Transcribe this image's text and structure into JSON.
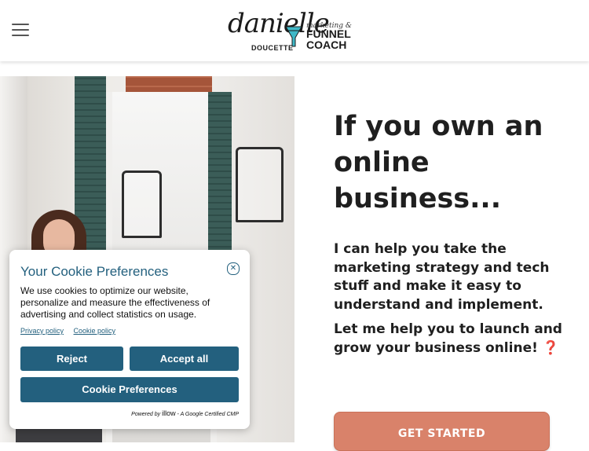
{
  "header": {
    "menu_icon": "hamburger-menu-icon",
    "logo": {
      "script_name": "danielle",
      "surname": "DOUCETTE",
      "tagline_top": "marketing &",
      "tagline_mid": "FUNNEL",
      "tagline_bottom": "COACH"
    }
  },
  "hero": {
    "headline": "If you own an online business...",
    "paragraph1": "I can help you take the marketing strategy and tech stuff and make it easy to understand and implement.",
    "paragraph2": "Let me help you to launch and grow your business online! ❓",
    "cta_label": "GET STARTED"
  },
  "cookie": {
    "title": "Your Cookie Preferences",
    "description": "We use cookies to optimize our website, personalize and measure the effectiveness of advertising and collect statistics on usage.",
    "privacy_link": "Privacy policy",
    "cookie_link": "Cookie policy",
    "reject_label": "Reject",
    "accept_label": "Accept all",
    "preferences_label": "Cookie Preferences",
    "powered_prefix": "Powered by",
    "powered_brand": "illow",
    "powered_suffix": "- A Google Certified CMP",
    "close_icon": "close-icon"
  },
  "colors": {
    "cookie_accent": "#23607e",
    "cta": "#d9826a",
    "text": "#1f1f1f"
  }
}
